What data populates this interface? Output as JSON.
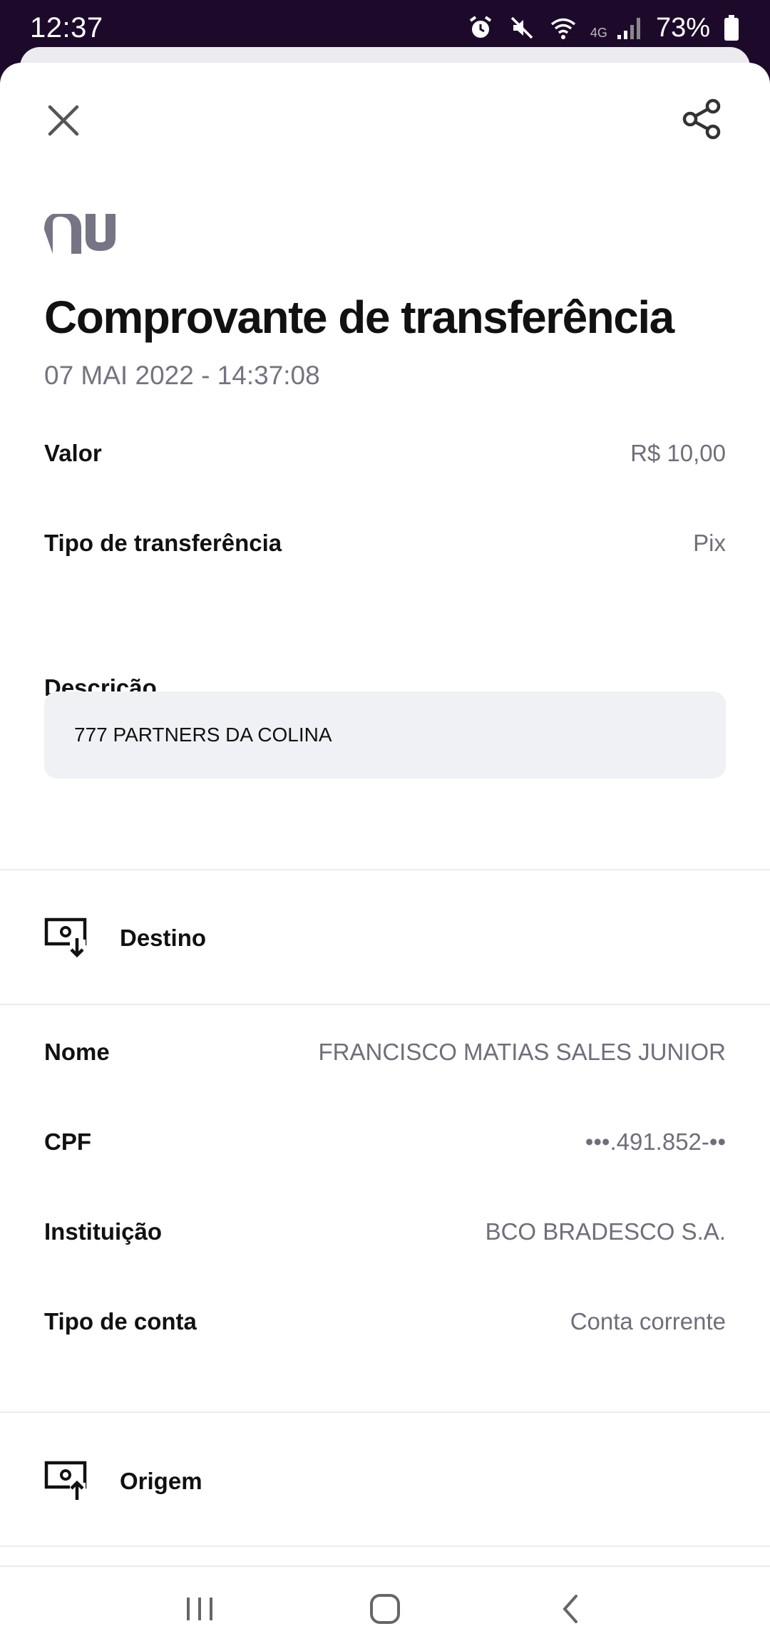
{
  "status_bar": {
    "time": "12:37",
    "network": "4G",
    "battery": "73%"
  },
  "header": {
    "close_icon": "close-icon",
    "share_icon": "share-icon",
    "logo_text": "nu"
  },
  "receipt": {
    "title": "Comprovante de transferência",
    "datetime": "07 MAI 2022 - 14:37:08",
    "fields": [
      {
        "label": "Valor",
        "value": "R$ 10,00"
      },
      {
        "label": "Tipo de transferência",
        "value": "Pix"
      }
    ],
    "description_label": "Descrição",
    "description": "777 PARTNERS DA COLINA"
  },
  "destination": {
    "title": "Destino",
    "icon": "money-receive-icon",
    "fields": [
      {
        "label": "Nome",
        "value": "FRANCISCO MATIAS SALES JUNIOR"
      },
      {
        "label": "CPF",
        "value": "•••.491.852-••"
      },
      {
        "label": "Instituição",
        "value": "BCO BRADESCO S.A."
      },
      {
        "label": "Tipo de conta",
        "value": "Conta corrente"
      }
    ]
  },
  "origin": {
    "title": "Origem",
    "icon": "money-send-icon"
  },
  "nav_bar": {
    "recent_icon": "recent-apps-icon",
    "home_icon": "home-icon",
    "back_icon": "back-icon"
  },
  "colors": {
    "status_bar_bg": "#1d0a2b",
    "label_text": "#111111",
    "value_text": "#6f6e7c",
    "logo": "#767585",
    "description_bg": "#f0f1f5"
  }
}
